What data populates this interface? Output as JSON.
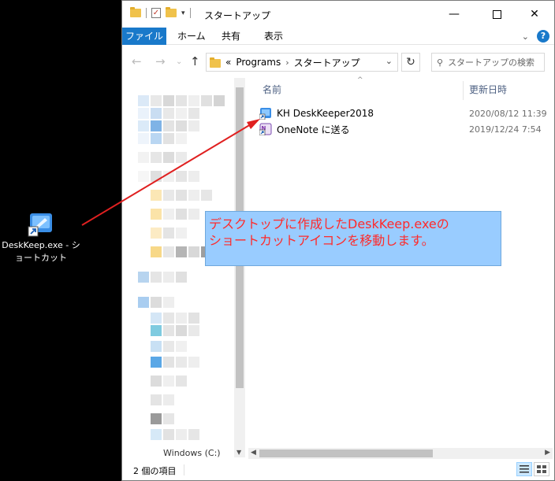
{
  "desktop": {
    "shortcut_label_1": "DeskKeep.exe - シ",
    "shortcut_label_2": "ョートカット"
  },
  "window": {
    "title": "スタートアップ",
    "ribbon": {
      "tabs": [
        "ファイル",
        "ホーム",
        "共有",
        "表示"
      ],
      "help": "?"
    },
    "address": {
      "overflow": "«",
      "crumbs": [
        "Programs",
        "スタートアップ"
      ]
    },
    "search": {
      "placeholder": "スタートアップの検索"
    },
    "nav_pane": {
      "drive_label": "Windows (C:)"
    },
    "columns": {
      "name": "名前",
      "date": "更新日時"
    },
    "files": [
      {
        "name": "KH DeskKeeper2018",
        "date": "2020/08/12 11:39",
        "icon": "shortcut-app-icon"
      },
      {
        "name": "OneNote に送る",
        "date": "2019/12/24 7:54",
        "icon": "onenote-icon"
      }
    ],
    "status": {
      "item_count": "2 個の項目"
    }
  },
  "annotation": {
    "line1": "デスクトップに作成したDeskKeep.exeの",
    "line2": "ショートカットアイコンを移動します。",
    "text_color": "#ff2a2a",
    "box_color": "#99ccff",
    "arrow_color": "#e02020"
  }
}
